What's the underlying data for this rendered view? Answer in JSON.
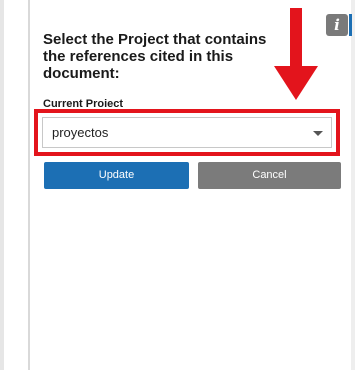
{
  "dialog": {
    "prompt": "Select the Project that contains the references cited in this document:",
    "current_project_label": "Current Project",
    "info_icon_glyph": "i"
  },
  "select": {
    "value": "proyectos"
  },
  "buttons": {
    "update_label": "Update",
    "cancel_label": "Cancel"
  },
  "colors": {
    "accent": "#1c6fb4",
    "cancel": "#7b7b7b",
    "highlight": "#e3141c",
    "arrow": "#e3141c"
  }
}
